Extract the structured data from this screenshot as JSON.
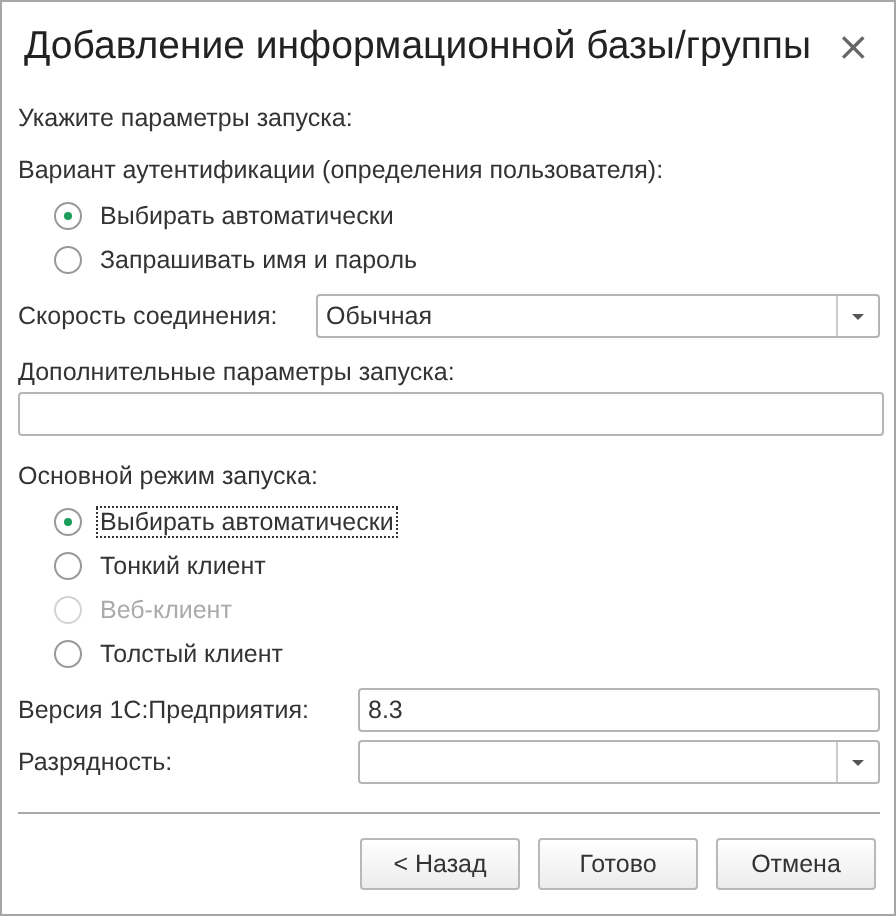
{
  "window": {
    "title": "Добавление информационной базы/группы",
    "close": "×"
  },
  "intro": "Укажите параметры запуска:",
  "auth": {
    "label": "Вариант аутентификации (определения пользователя):",
    "options": [
      {
        "label": "Выбирать автоматически",
        "selected": true,
        "disabled": false,
        "focused": false
      },
      {
        "label": "Запрашивать имя и пароль",
        "selected": false,
        "disabled": false,
        "focused": false
      }
    ]
  },
  "speed": {
    "label": "Скорость соединения:",
    "value": "Обычная"
  },
  "extra": {
    "label": "Дополнительные параметры запуска:"
  },
  "mode": {
    "label": "Основной режим запуска:",
    "options": [
      {
        "label": "Выбирать автоматически",
        "selected": true,
        "disabled": false,
        "focused": true
      },
      {
        "label": "Тонкий клиент",
        "selected": false,
        "disabled": false,
        "focused": false
      },
      {
        "label": "Веб-клиент",
        "selected": false,
        "disabled": true,
        "focused": false
      },
      {
        "label": "Толстый клиент",
        "selected": false,
        "disabled": false,
        "focused": false
      }
    ]
  },
  "version": {
    "label": "Версия 1С:Предприятия:",
    "value": "8.3"
  },
  "bitness": {
    "label": "Разрядность:"
  },
  "buttons": [
    "< Назад",
    "Готово",
    "Отмена"
  ]
}
